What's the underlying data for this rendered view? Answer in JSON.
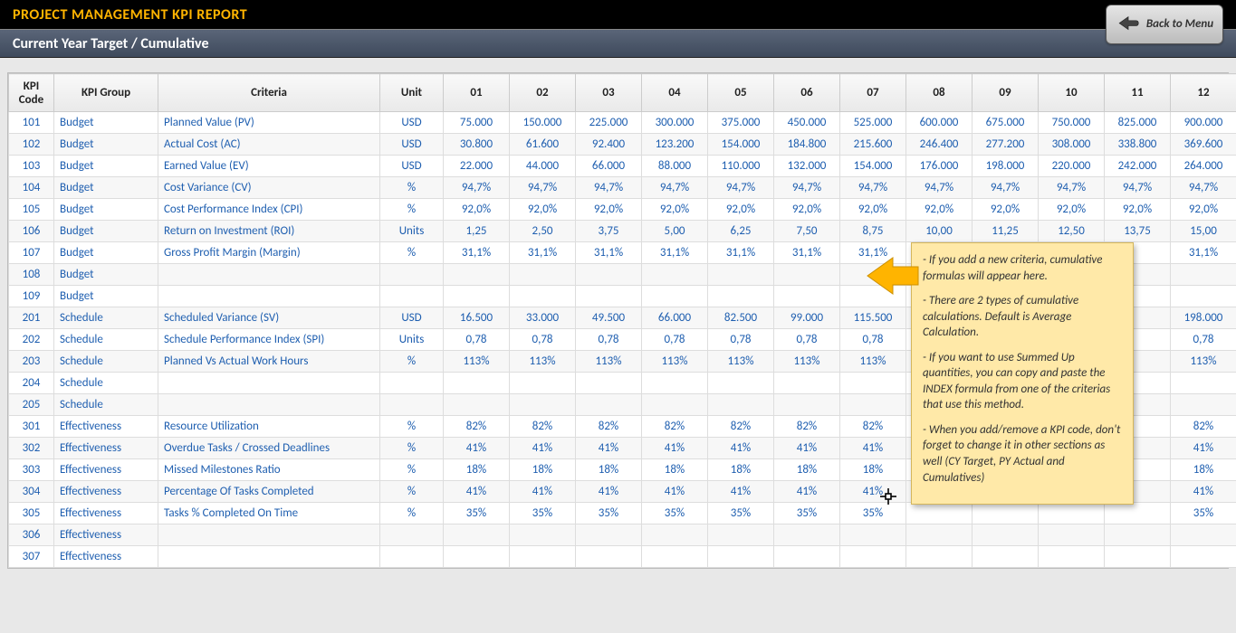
{
  "header": {
    "title": "PROJECT MANAGEMENT KPI REPORT",
    "subtitle": "Current Year Target / Cumulative",
    "back_button": "Back to Menu"
  },
  "columns": {
    "code": "KPI Code",
    "group": "KPI Group",
    "criteria": "Criteria",
    "unit": "Unit",
    "months": [
      "01",
      "02",
      "03",
      "04",
      "05",
      "06",
      "07",
      "08",
      "09",
      "10",
      "11",
      "12"
    ]
  },
  "rows": [
    {
      "code": "101",
      "group": "Budget",
      "criteria": "Planned Value (PV)",
      "unit": "USD",
      "values": [
        "75.000",
        "150.000",
        "225.000",
        "300.000",
        "375.000",
        "450.000",
        "525.000",
        "600.000",
        "675.000",
        "750.000",
        "825.000",
        "900.000"
      ]
    },
    {
      "code": "102",
      "group": "Budget",
      "criteria": "Actual Cost (AC)",
      "unit": "USD",
      "values": [
        "30.800",
        "61.600",
        "92.400",
        "123.200",
        "154.000",
        "184.800",
        "215.600",
        "246.400",
        "277.200",
        "308.000",
        "338.800",
        "369.600"
      ]
    },
    {
      "code": "103",
      "group": "Budget",
      "criteria": "Earned Value (EV)",
      "unit": "USD",
      "values": [
        "22.000",
        "44.000",
        "66.000",
        "88.000",
        "110.000",
        "132.000",
        "154.000",
        "176.000",
        "198.000",
        "220.000",
        "242.000",
        "264.000"
      ]
    },
    {
      "code": "104",
      "group": "Budget",
      "criteria": "Cost Variance (CV)",
      "unit": "%",
      "values": [
        "94,7%",
        "94,7%",
        "94,7%",
        "94,7%",
        "94,7%",
        "94,7%",
        "94,7%",
        "94,7%",
        "94,7%",
        "94,7%",
        "94,7%",
        "94,7%"
      ]
    },
    {
      "code": "105",
      "group": "Budget",
      "criteria": "Cost Performance Index (CPI)",
      "unit": "%",
      "values": [
        "92,0%",
        "92,0%",
        "92,0%",
        "92,0%",
        "92,0%",
        "92,0%",
        "92,0%",
        "92,0%",
        "92,0%",
        "92,0%",
        "92,0%",
        "92,0%"
      ]
    },
    {
      "code": "106",
      "group": "Budget",
      "criteria": "Return on Investment (ROI)",
      "unit": "Units",
      "values": [
        "1,25",
        "2,50",
        "3,75",
        "5,00",
        "6,25",
        "7,50",
        "8,75",
        "10,00",
        "11,25",
        "12,50",
        "13,75",
        "15,00"
      ]
    },
    {
      "code": "107",
      "group": "Budget",
      "criteria": "Gross Profit Margin (Margin)",
      "unit": "%",
      "values": [
        "31,1%",
        "31,1%",
        "31,1%",
        "31,1%",
        "31,1%",
        "31,1%",
        "31,1%",
        "",
        "",
        "",
        "",
        "31,1%"
      ]
    },
    {
      "code": "108",
      "group": "Budget",
      "criteria": "",
      "unit": "",
      "values": [
        "",
        "",
        "",
        "",
        "",
        "",
        "",
        "",
        "",
        "",
        "",
        ""
      ]
    },
    {
      "code": "109",
      "group": "Budget",
      "criteria": "",
      "unit": "",
      "values": [
        "",
        "",
        "",
        "",
        "",
        "",
        "",
        "",
        "",
        "",
        "",
        ""
      ]
    },
    {
      "code": "201",
      "group": "Schedule",
      "criteria": "Scheduled Variance (SV)",
      "unit": "USD",
      "values": [
        "16.500",
        "33.000",
        "49.500",
        "66.000",
        "82.500",
        "99.000",
        "115.500",
        "",
        "",
        "",
        "",
        "198.000"
      ]
    },
    {
      "code": "202",
      "group": "Schedule",
      "criteria": "Schedule Performance Index (SPI)",
      "unit": "Units",
      "values": [
        "0,78",
        "0,78",
        "0,78",
        "0,78",
        "0,78",
        "0,78",
        "0,78",
        "",
        "",
        "",
        "",
        "0,78"
      ]
    },
    {
      "code": "203",
      "group": "Schedule",
      "criteria": "Planned Vs Actual Work Hours",
      "unit": "%",
      "values": [
        "113%",
        "113%",
        "113%",
        "113%",
        "113%",
        "113%",
        "113%",
        "",
        "",
        "",
        "",
        "113%"
      ]
    },
    {
      "code": "204",
      "group": "Schedule",
      "criteria": "",
      "unit": "",
      "values": [
        "",
        "",
        "",
        "",
        "",
        "",
        "",
        "",
        "",
        "",
        "",
        ""
      ]
    },
    {
      "code": "205",
      "group": "Schedule",
      "criteria": "",
      "unit": "",
      "values": [
        "",
        "",
        "",
        "",
        "",
        "",
        "",
        "",
        "",
        "",
        "",
        ""
      ]
    },
    {
      "code": "301",
      "group": "Effectiveness",
      "criteria": "Resource Utilization",
      "unit": "%",
      "values": [
        "82%",
        "82%",
        "82%",
        "82%",
        "82%",
        "82%",
        "82%",
        "",
        "",
        "",
        "",
        "82%"
      ]
    },
    {
      "code": "302",
      "group": "Effectiveness",
      "criteria": "Overdue Tasks / Crossed Deadlines",
      "unit": "%",
      "values": [
        "41%",
        "41%",
        "41%",
        "41%",
        "41%",
        "41%",
        "41%",
        "",
        "",
        "",
        "",
        "41%"
      ]
    },
    {
      "code": "303",
      "group": "Effectiveness",
      "criteria": "Missed Milestones Ratio",
      "unit": "%",
      "values": [
        "18%",
        "18%",
        "18%",
        "18%",
        "18%",
        "18%",
        "18%",
        "",
        "",
        "",
        "",
        "18%"
      ]
    },
    {
      "code": "304",
      "group": "Effectiveness",
      "criteria": "Percentage Of Tasks Completed",
      "unit": "%",
      "values": [
        "41%",
        "41%",
        "41%",
        "41%",
        "41%",
        "41%",
        "41%",
        "",
        "",
        "",
        "",
        "41%"
      ]
    },
    {
      "code": "305",
      "group": "Effectiveness",
      "criteria": "Tasks % Completed On Time",
      "unit": "%",
      "values": [
        "35%",
        "35%",
        "35%",
        "35%",
        "35%",
        "35%",
        "35%",
        "",
        "",
        "",
        "",
        "35%"
      ]
    },
    {
      "code": "306",
      "group": "Effectiveness",
      "criteria": "",
      "unit": "",
      "values": [
        "",
        "",
        "",
        "",
        "",
        "",
        "",
        "",
        "",
        "",
        "",
        ""
      ]
    },
    {
      "code": "307",
      "group": "Effectiveness",
      "criteria": "",
      "unit": "",
      "values": [
        "",
        "",
        "",
        "",
        "",
        "",
        "",
        "",
        "",
        "",
        "",
        ""
      ]
    }
  ],
  "tooltip": {
    "p1": "- If you add a new criteria, cumulative formulas will appear here.",
    "p2": "- There are 2 types of cumulative calculations. Default is Average Calculation.",
    "p3": "- If you want to use Summed Up quantities, you can copy and paste the INDEX formula from one of the criterias that use this method.",
    "p4": "- When you add/remove a KPI code, don't forget to change it in other sections as well (CY Target, PY Actual and Cumulatives)"
  }
}
